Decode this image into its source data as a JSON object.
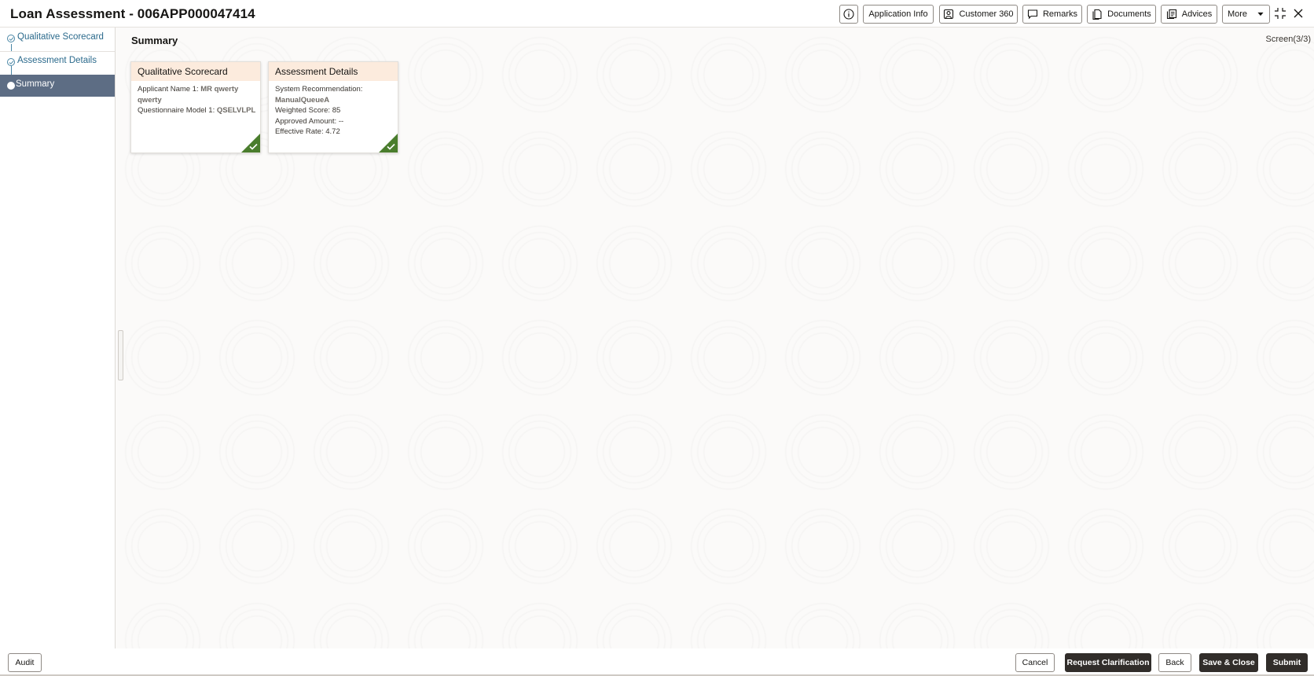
{
  "header": {
    "title": "Loan Assessment - 006APP000047414",
    "buttons": {
      "info_icon": "info-icon",
      "application_info": "Application Info",
      "customer_360": "Customer 360",
      "remarks": "Remarks",
      "documents": "Documents",
      "advices": "Advices",
      "more": "More"
    }
  },
  "sidebar": {
    "steps": [
      {
        "label": "Qualitative Scorecard",
        "state": "completed"
      },
      {
        "label": "Assessment Details",
        "state": "completed"
      },
      {
        "label": "Summary",
        "state": "active"
      }
    ]
  },
  "main": {
    "title": "Summary",
    "screen_count": "Screen(3/3)",
    "cards": [
      {
        "title": "Qualitative Scorecard",
        "lines": [
          {
            "label": "Applicant Name 1:",
            "value": "MR qwerty qwerty"
          },
          {
            "label": "Questionnaire Model 1:",
            "value": "QSELVLPL"
          }
        ],
        "status": "completed"
      },
      {
        "title": "Assessment Details",
        "lines": [
          {
            "label": "System Recommendation:",
            "value": "ManualQueueA"
          },
          {
            "label": "Weighted Score:",
            "value": "85"
          },
          {
            "label": "Approved Amount:",
            "value": "--"
          },
          {
            "label": "Effective Rate:",
            "value": "4.72"
          }
        ],
        "status": "completed"
      }
    ]
  },
  "footer": {
    "audit": "Audit",
    "cancel": "Cancel",
    "request_clarification": "Request Clarification",
    "back": "Back",
    "save_close": "Save & Close",
    "submit": "Submit"
  },
  "colors": {
    "primary_button": "#312d2a",
    "active_step": "#5d6d84",
    "card_header": "#fcebdd",
    "completed_badge": "#4a7d2d",
    "step_link": "#2b6a8c"
  }
}
